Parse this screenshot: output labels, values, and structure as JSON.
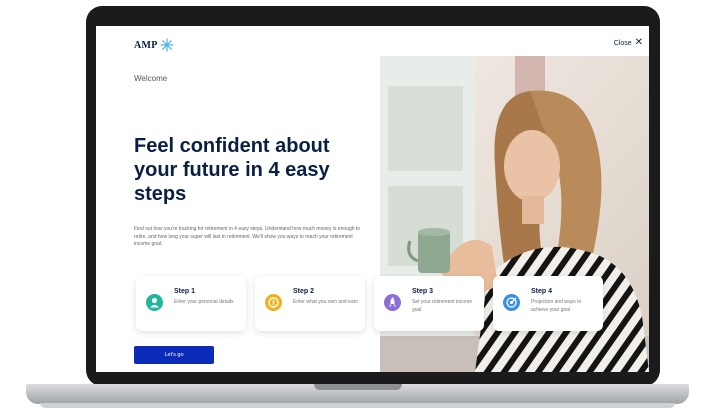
{
  "header": {
    "logo_text": "AMP",
    "close_label": "Close"
  },
  "intro": {
    "welcome": "Welcome",
    "headline": "Feel confident about your future in 4 easy steps",
    "description": "Find out how you're tracking for retirement in 4 easy steps. Understand how much money is enough to retire, and how long your super will last in retirement. We'll show you ways to reach your retirement income goal."
  },
  "steps": [
    {
      "title": "Step 1",
      "text": "Enter your personal details",
      "icon": "person-icon",
      "icon_color": "#1fb89a"
    },
    {
      "title": "Step 2",
      "text": "Enter what you own and earn",
      "icon": "coin-icon",
      "icon_color": "#f2b01e"
    },
    {
      "title": "Step 3",
      "text": "Set your retirement income goal",
      "icon": "rocket-icon",
      "icon_color": "#8b6fd8"
    },
    {
      "title": "Step 4",
      "text": "Projection and ways to achieve your goal",
      "icon": "target-icon",
      "icon_color": "#3a8fe0"
    }
  ],
  "cta": {
    "label": "Let's go"
  },
  "colors": {
    "primary": "#0a2cb8",
    "heading": "#0a1f44",
    "logo_accent": "#4fb3e6"
  }
}
